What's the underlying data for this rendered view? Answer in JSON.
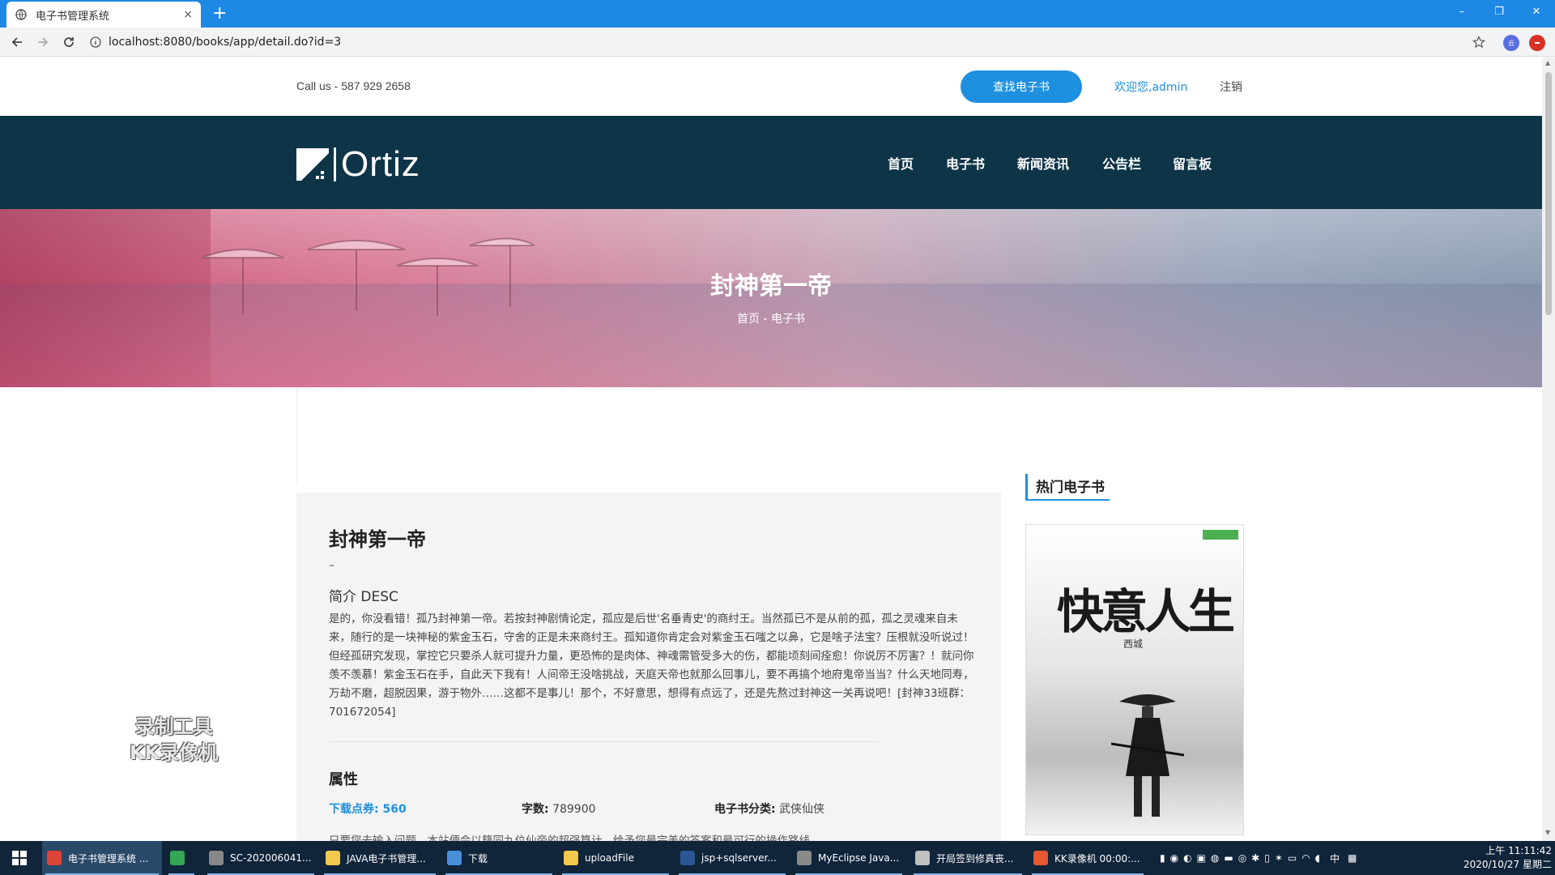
{
  "browser": {
    "tab_title": "电子书管理系统",
    "tab_close": "×",
    "new_tab": "+",
    "url": "localhost:8080/books/app/detail.do?id=3",
    "window_controls": [
      "–",
      "❐",
      "✕"
    ],
    "ext_label": "云"
  },
  "topbar": {
    "call": "Call us - 587 929 2658",
    "search_button": "查找电子书",
    "welcome": "欢迎您,admin",
    "logout": "注销"
  },
  "navbar": {
    "logo_text": "Ortiz",
    "menu": [
      "首页",
      "电子书",
      "新闻资讯",
      "公告栏",
      "留言板"
    ]
  },
  "hero": {
    "title": "封神第一帝",
    "breadcrumb": "首页 - 电子书"
  },
  "detail": {
    "title": "封神第一帝",
    "dash": "–",
    "desc_heading": "简介 DESC",
    "desc_body": "是的，你没看错！孤乃封神第一帝。若按封神剧情论定，孤应是后世'名垂青史'的商纣王。当然孤已不是从前的孤，孤之灵魂来自未来，随行的是一块神秘的紫金玉石，守舍的正是未来商纣王。孤知道你肯定会对紫金玉石嗤之以鼻，它是啥子法宝？压根就没听说过！但经孤研究发现，掌控它只要杀人就可提升力量，更恐怖的是肉体、神魂需管受多大的伤，都能顷刻间痊愈！你说厉不厉害？！就问你羡不羡慕！紫金玉石在手，自此天下我有！人间帝王没啥挑战，天庭天帝也就那么回事儿，要不再搞个地府鬼帝当当？什么天地同寿，万劫不磨，超脱因果，游于物外……这都不是事儿！那个，不好意思，想得有点远了，还是先熬过封神这一关再说吧！[封神33班群：701672054]",
    "attr_heading": "属性",
    "download": "下载点券: 560",
    "words_label": "字数:",
    "words_value": "789900",
    "category_label": "电子书分类:",
    "category_value": "武侠仙侠",
    "cut_text": "只要您去输入问题，本站便会以籍同九位仙帝的超强算计，给予您最完美的答案和最可行的操作路线"
  },
  "sidebar": {
    "heading": "热门电子书",
    "cover_title": "快意人生",
    "cover_author": "西城"
  },
  "watermark": {
    "line1": "录制工具",
    "line2": "KK录像机"
  },
  "taskbar": {
    "items": [
      {
        "label": "电子书管理系统 ...",
        "color": "#db4437"
      },
      {
        "label": "",
        "color": "#34a853"
      },
      {
        "label": "SC-202006041...",
        "color": "#888888"
      },
      {
        "label": "JAVA电子书管理...",
        "color": "#f2c94c"
      },
      {
        "label": "下载",
        "color": "#4a90d9"
      },
      {
        "label": "uploadFile",
        "color": "#f2c94c"
      },
      {
        "label": "jsp+sqlserver...",
        "color": "#2b5797"
      },
      {
        "label": "MyEclipse Java...",
        "color": "#8a8a8a"
      },
      {
        "label": "开局签到修真丧...",
        "color": "#c0c0c0"
      },
      {
        "label": "KK录像机 00:00:...",
        "color": "#e8572d"
      }
    ],
    "ime": "中",
    "time": "上午 11:11:42",
    "date": "2020/10/27 星期二"
  },
  "colors": {
    "accent": "#1e90e0",
    "navbar_bg": "#0e3547",
    "taskbar_bg": "#10243a"
  }
}
